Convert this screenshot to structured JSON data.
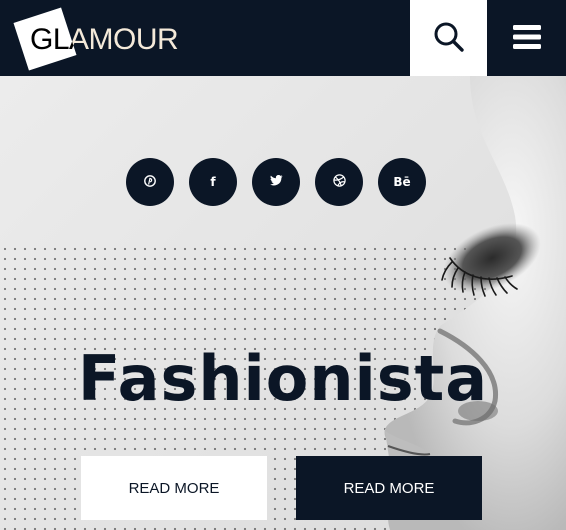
{
  "header": {
    "logo_text": "GLAMOUR",
    "search_icon": "search-icon",
    "menu_icon": "hamburger-menu-icon"
  },
  "hero": {
    "social_icons": [
      "pinterest-icon",
      "facebook-icon",
      "twitter-icon",
      "dribbble-icon",
      "behance-icon"
    ],
    "social_glyphs": {
      "facebook": "f",
      "behance": "Bē"
    },
    "headline": "Fashionista",
    "buttons": {
      "primary_label": "READ MORE",
      "secondary_label": "READ MORE"
    }
  },
  "colors": {
    "navy": "#0b1626",
    "white": "#ffffff",
    "hero_bg": "#e9e9e9"
  }
}
